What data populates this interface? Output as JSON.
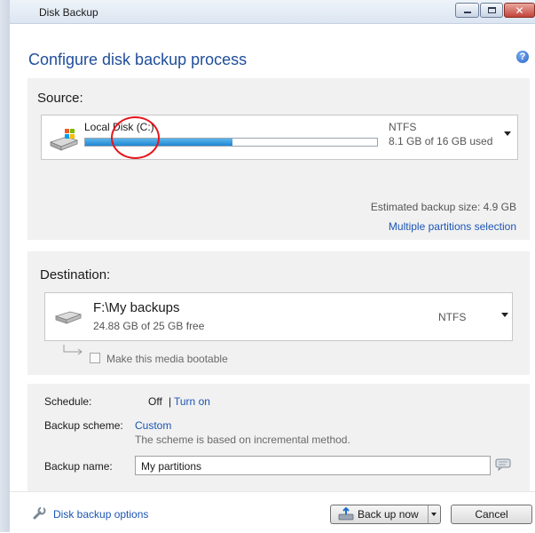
{
  "window": {
    "title": "Disk Backup",
    "close_glyph": "✕"
  },
  "header": {
    "title": "Configure disk backup process",
    "help_glyph": "?"
  },
  "source": {
    "label": "Source:",
    "disk_name": "Local Disk (C:)",
    "filesystem": "NTFS",
    "usage": "8.1 GB of 16 GB used",
    "used_fraction": 0.506,
    "estimated_size": "Estimated backup size: 4.9 GB",
    "multiple_partitions_link": "Multiple partitions selection"
  },
  "destination": {
    "label": "Destination:",
    "path": "F:\\My backups",
    "free_space": "24.88 GB of 25 GB free",
    "filesystem": "NTFS",
    "bootable_label": "Make this media bootable"
  },
  "schedule": {
    "label": "Schedule:",
    "state": "Off",
    "separator": "|",
    "turn_on_link": "Turn on"
  },
  "backup_scheme": {
    "label": "Backup scheme:",
    "value": "Custom",
    "description": "The scheme is based on incremental method."
  },
  "backup_name": {
    "label": "Backup name:",
    "value": "My partitions"
  },
  "footer": {
    "options_link": "Disk backup options",
    "back_up_now": "Back up now",
    "cancel": "Cancel"
  },
  "colors": {
    "accent": "#1f4e9c",
    "link": "#1c55b3",
    "annotation": "#e8141c"
  }
}
